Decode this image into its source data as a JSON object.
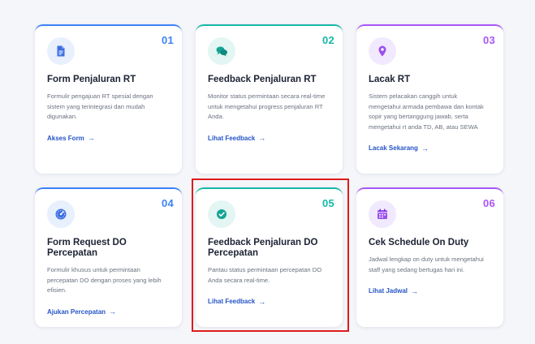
{
  "cards": [
    {
      "number": "01",
      "title": "Form Penjaluran RT",
      "description": "Formulir pengajuan RT spesial dengan sistem yang terintegrasi dan mudah digunakan.",
      "link": "Akses Form",
      "icon": "document-icon"
    },
    {
      "number": "02",
      "title": "Feedback Penjaluran RT",
      "description": "Monitor status permintaan secara real-time untuk mengetahui progress penjaluran RT Anda.",
      "link": "Lihat Feedback",
      "icon": "chat-bubbles-icon"
    },
    {
      "number": "03",
      "title": "Lacak RT",
      "description": "Sistem pelacakan canggih untuk mengetahui armada pembawa dan kontak sopir yang bertanggung jawab, serta mengetahui rt anda TD, AB, atau SEWA",
      "link": "Lacak Sekarang",
      "icon": "location-pin-icon"
    },
    {
      "number": "04",
      "title": "Form Request DO Percepatan",
      "description": "Formulir khusus untuk permintaan percepatan DO dengan proses yang lebih efisien.",
      "link": "Ajukan Percepatan",
      "icon": "speedometer-icon"
    },
    {
      "number": "05",
      "title": "Feedback Penjaluran DO Percepatan",
      "description": "Pantau status permintaan percepatan DO Anda secara real-time.",
      "link": "Lihat Feedback",
      "icon": "check-circle-icon"
    },
    {
      "number": "06",
      "title": "Cek Schedule On Duty",
      "description": "Jadwal lengkap on duty untuk mengetahui staff yang sedang bertugas hari ini.",
      "link": "Lihat Jadwal",
      "icon": "calendar-icon"
    }
  ],
  "arrow_glyph": "→",
  "colors": {
    "blue": "#3b82f6",
    "teal": "#14b8a6",
    "purple": "#a855f7",
    "link": "#2554c7",
    "highlight": "#dd1c1c"
  }
}
